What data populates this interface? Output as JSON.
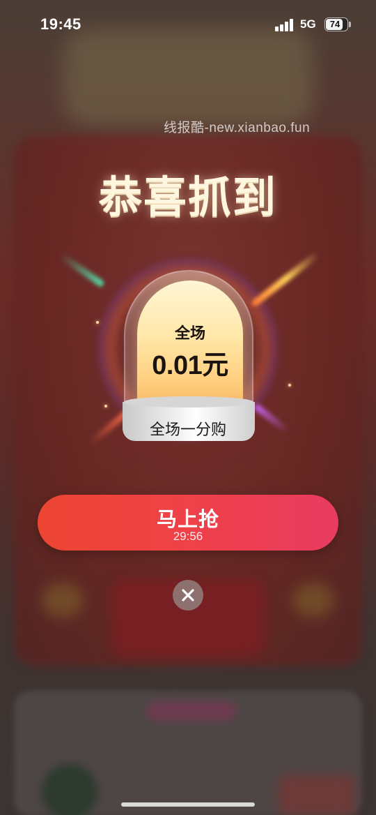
{
  "status_bar": {
    "time": "19:45",
    "network": "5G",
    "battery": "74",
    "battery_level": 0.74
  },
  "watermark": "线报酷-new.xianbao.fun",
  "title": "恭喜抓到",
  "prize": {
    "scope": "全场",
    "price": "0.01元",
    "base_label": "全场一分购"
  },
  "cta": {
    "label": "马上抢",
    "countdown": "29:56"
  },
  "colors": {
    "cta_start": "#ec4532",
    "cta_end": "#e83b61",
    "title": "#fff6df",
    "card": "#ffe7a8"
  },
  "icons": {
    "close": "close-icon",
    "signal": "signal-icon",
    "battery": "battery-icon"
  }
}
